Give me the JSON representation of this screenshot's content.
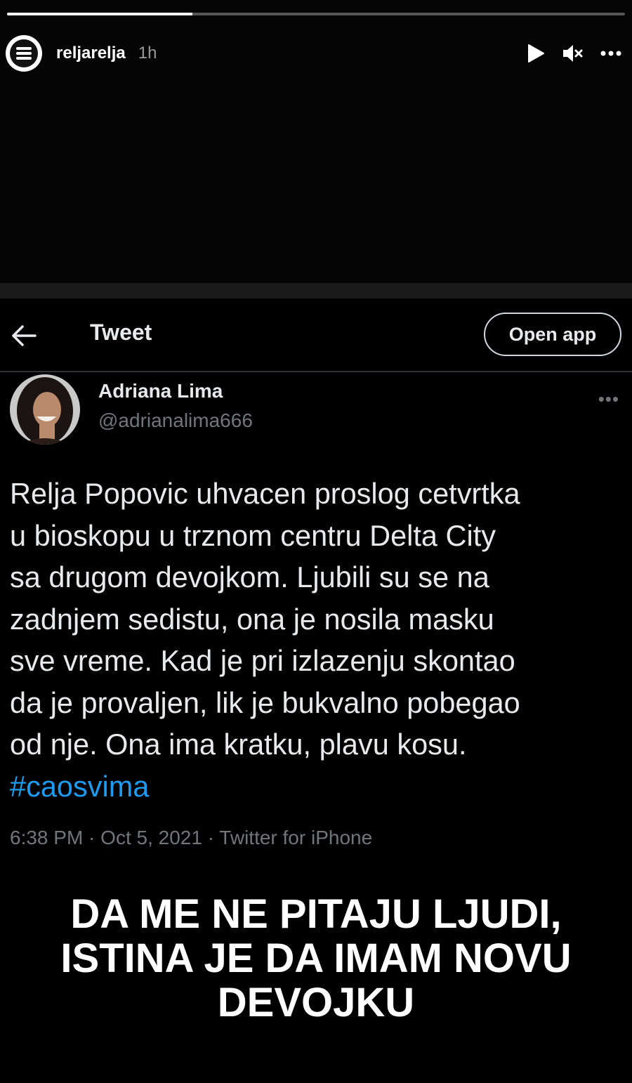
{
  "story": {
    "progress": 0.3,
    "username": "reljarelja",
    "time": "1h",
    "icons": {
      "logo": "channel-logo-icon",
      "play": "play-icon",
      "mute": "mute-icon",
      "more": "more-icon"
    }
  },
  "tweet_view": {
    "title": "Tweet",
    "open_app": "Open app",
    "back_icon": "back-arrow-icon",
    "author_name": "Adriana Lima",
    "author_handle": "@adrianalima666",
    "more": "•••",
    "text_lines": [
      "Relja Popovic uhvacen proslog cetvrtka",
      "u bioskopu u trznom centru Delta City",
      "sa drugom devojkom. Ljubili su se na",
      "zadnjem sedistu, ona je nosila masku",
      "sve vreme. Kad je pri izlazenju skontao",
      "da je provaljen, lik je bukvalno pobegao",
      "od nje. Ona ima kratku, plavu kosu."
    ],
    "hashtag": "#caosvima",
    "meta": "6:38 PM · Oct 5, 2021 · Twitter for iPhone"
  },
  "caption_lines": [
    "DA ME NE PITAJU LJUDI,",
    "ISTINA JE DA IMAM NOVU",
    "DEVOJKU"
  ],
  "colors": {
    "background": "#050505",
    "link": "#1d9bf0",
    "muted": "#71767b",
    "text": "#e7e9ea"
  }
}
